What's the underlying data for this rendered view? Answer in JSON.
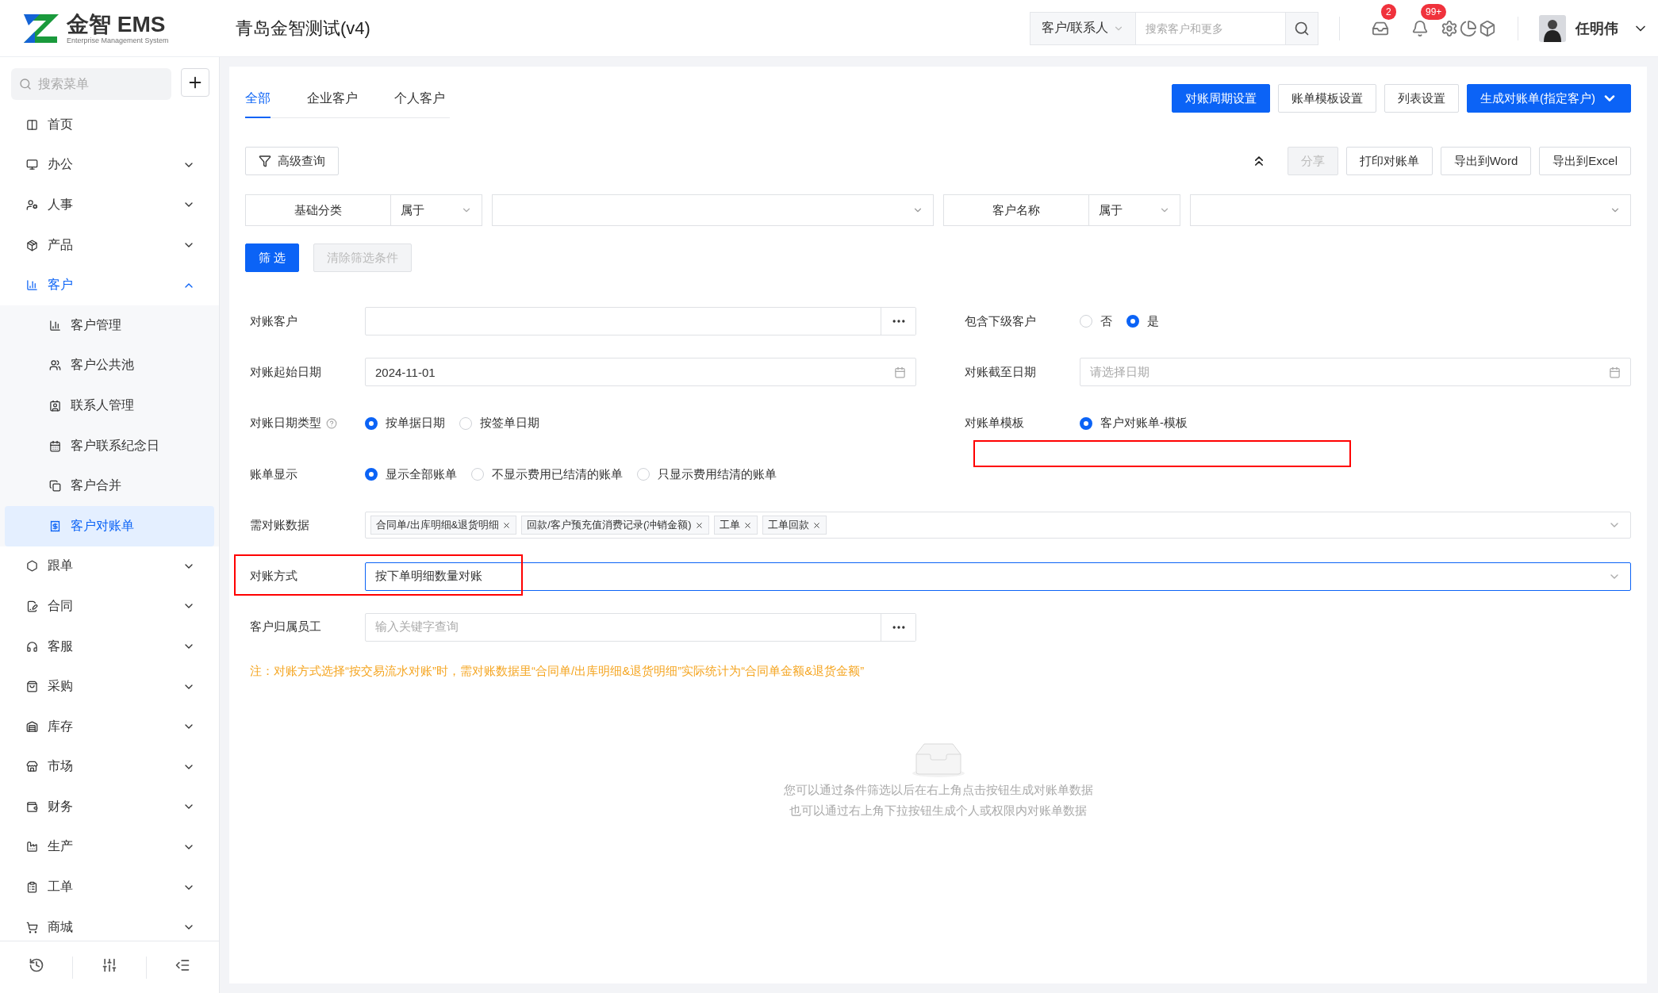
{
  "header": {
    "brand": "金智 EMS",
    "brand_subtitle": "Enterprise Management System",
    "title": "青岛金智测试(v4)",
    "search": {
      "scope": "客户/联系人",
      "placeholder": "搜索客户和更多"
    },
    "message_badge": "2",
    "notification_badge": "99+",
    "user": {
      "name": "任明伟"
    }
  },
  "sidebar": {
    "search": {
      "placeholder": "搜索菜单"
    },
    "items": [
      {
        "label": "首页",
        "kind": "link",
        "selected": false
      },
      {
        "label": "办公",
        "kind": "group",
        "expanded": false,
        "selected": false
      },
      {
        "label": "人事",
        "kind": "group",
        "expanded": false,
        "selected": false
      },
      {
        "label": "产品",
        "kind": "group",
        "expanded": false,
        "selected": false
      },
      {
        "label": "客户",
        "kind": "group",
        "expanded": true,
        "selected": true,
        "children": [
          {
            "label": "客户管理",
            "selected": false
          },
          {
            "label": "客户公共池",
            "selected": false
          },
          {
            "label": "联系人管理",
            "selected": false
          },
          {
            "label": "客户联系纪念日",
            "selected": false
          },
          {
            "label": "客户合并",
            "selected": false
          },
          {
            "label": "客户对账单",
            "selected": true
          }
        ]
      },
      {
        "label": "跟单",
        "kind": "group",
        "expanded": false,
        "selected": false
      },
      {
        "label": "合同",
        "kind": "group",
        "expanded": false,
        "selected": false
      },
      {
        "label": "客服",
        "kind": "group",
        "expanded": false,
        "selected": false
      },
      {
        "label": "采购",
        "kind": "group",
        "expanded": false,
        "selected": false
      },
      {
        "label": "库存",
        "kind": "group",
        "expanded": false,
        "selected": false
      },
      {
        "label": "市场",
        "kind": "group",
        "expanded": false,
        "selected": false
      },
      {
        "label": "财务",
        "kind": "group",
        "expanded": false,
        "selected": false
      },
      {
        "label": "生产",
        "kind": "group",
        "expanded": false,
        "selected": false
      },
      {
        "label": "工单",
        "kind": "group",
        "expanded": false,
        "selected": false
      },
      {
        "label": "商城",
        "kind": "group",
        "expanded": false,
        "selected": false
      }
    ]
  },
  "tabs": [
    {
      "label": "全部",
      "selected": true
    },
    {
      "label": "企业客户",
      "selected": false
    },
    {
      "label": "个人客户",
      "selected": false
    }
  ],
  "actions": [
    {
      "label": "对账周期设置",
      "kind": "primary"
    },
    {
      "label": "账单模板设置",
      "kind": "default"
    },
    {
      "label": "列表设置",
      "kind": "default"
    },
    {
      "label": "生成对账单(指定客户)",
      "kind": "dropdown"
    }
  ],
  "toolbar": {
    "advanced": "高级查询",
    "buttons": [
      {
        "label": "分享",
        "disabled": true
      },
      {
        "label": "打印对账单",
        "disabled": false
      },
      {
        "label": "导出到Word",
        "disabled": false
      },
      {
        "label": "导出到Excel",
        "disabled": false
      }
    ]
  },
  "filters": [
    {
      "field": "基础分类",
      "operator": "属于"
    },
    {
      "field": "客户名称",
      "operator": "属于"
    }
  ],
  "filter_buttons": [
    {
      "label": "筛 选",
      "disabled": false
    },
    {
      "label": "清除筛选条件",
      "disabled": true
    }
  ],
  "form": {
    "rows": [
      {
        "cells": [
          {
            "label": "对账客户",
            "kind": "picker"
          },
          {
            "label": "包含下级客户",
            "kind": "radio",
            "options": [
              {
                "label": "否",
                "selected": false
              },
              {
                "label": "是",
                "selected": true
              }
            ]
          }
        ]
      },
      {
        "cells": [
          {
            "label": "对账起始日期",
            "kind": "date",
            "value": "2024-11-01"
          },
          {
            "label": "对账截至日期",
            "kind": "date",
            "placeholder": "请选择日期"
          }
        ]
      },
      {
        "cells": [
          {
            "label": "对账日期类型",
            "kind": "radio",
            "help": true,
            "options": [
              {
                "label": "按单据日期",
                "selected": true
              },
              {
                "label": "按签单日期",
                "selected": false
              }
            ]
          },
          {
            "label": "对账单模板",
            "kind": "radio",
            "options": [
              {
                "label": "客户对账单-模板",
                "selected": true
              }
            ]
          }
        ]
      },
      {
        "cells": [
          {
            "label": "账单显示",
            "kind": "radio",
            "options": [
              {
                "label": "显示全部账单",
                "selected": true
              },
              {
                "label": "不显示费用已结清的账单",
                "selected": false
              },
              {
                "label": "只显示费用结清的账单",
                "selected": false
              }
            ]
          }
        ]
      },
      {
        "cells": [
          {
            "label": "需对账数据",
            "kind": "tags",
            "tags": [
              "合同单/出库明细&退货明细",
              "回款/客户预充值消费记录(冲销金额)",
              "工单",
              "工单回款"
            ]
          }
        ]
      },
      {
        "cells": [
          {
            "label": "对账方式",
            "kind": "select",
            "value": "按下单明细数量对账",
            "highlighted": true
          }
        ]
      },
      {
        "cells": [
          {
            "label": "客户归属员工",
            "kind": "picker",
            "placeholder": "输入关键字查询"
          }
        ]
      }
    ],
    "markup_boxes": [
      {
        "kind": "rectangle"
      }
    ],
    "note": "注：对账方式选择“按交易流水对账”时，需对账数据里“合同单/出库明细&退货明细”实际统计为“合同单金额&退货金额”"
  },
  "empty_state": [
    "您可以通过条件筛选以后在右上角点击按钮生成对账单数据",
    "也可以通过右上角下拉按钮生成个人或权限内对账单数据"
  ]
}
